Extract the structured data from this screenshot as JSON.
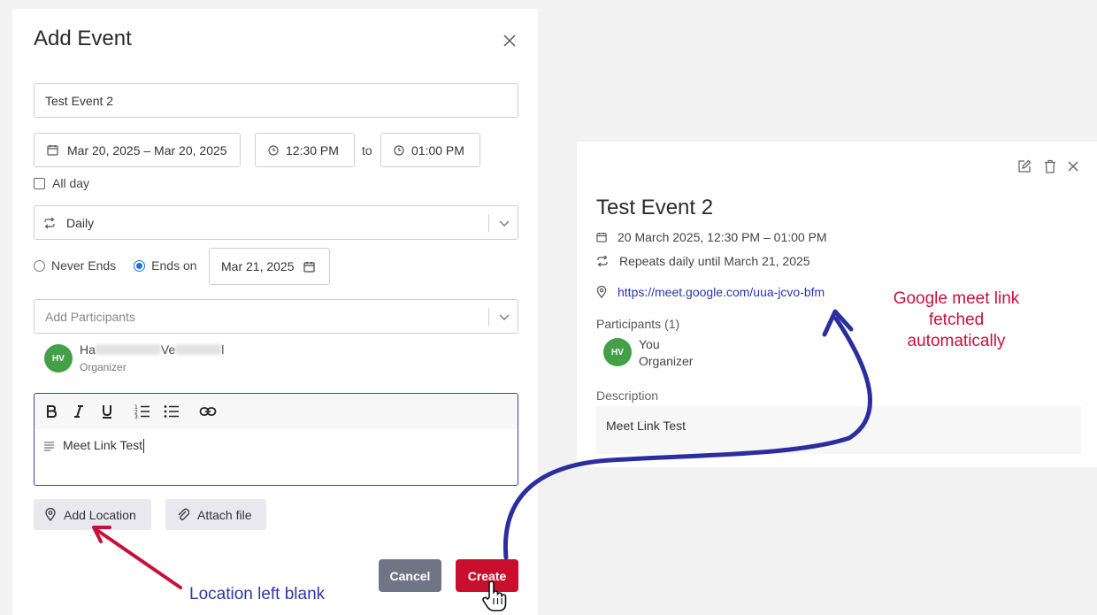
{
  "dialog": {
    "title": "Add Event",
    "event_title_value": "Test Event 2",
    "date_range": "Mar 20, 2025 – Mar 20, 2025",
    "start_time": "12:30 PM",
    "to_label": "to",
    "end_time": "01:00 PM",
    "all_day_label": "All day",
    "repeat_value": "Daily",
    "never_ends_label": "Never Ends",
    "ends_on_label": "Ends on",
    "ends_on_date": "Mar 21, 2025",
    "participants_placeholder": "Add Participants",
    "organizer": {
      "initials": "HV",
      "name_part1": "Ha",
      "name_part2": "Ve",
      "name_part3": "l",
      "role": "Organizer"
    },
    "description_text": "Meet Link Test",
    "add_location_label": "Add Location",
    "attach_file_label": "Attach file",
    "cancel_label": "Cancel",
    "create_label": "Create"
  },
  "details": {
    "title": "Test Event 2",
    "datetime": "20 March 2025, 12:30 PM – 01:00 PM",
    "repeat": "Repeats daily until March 21, 2025",
    "meet_link": "https://meet.google.com/uua-jcvo-bfm",
    "participants_label": "Participants (1)",
    "participant_initials": "HV",
    "participant_name": "You",
    "participant_role": "Organizer",
    "description_label": "Description",
    "description_value": "Meet Link Test"
  },
  "annotations": {
    "meet_note_line1": "Google meet link",
    "meet_note_line2": "fetched",
    "meet_note_line3": "automatically",
    "location_note": "Location left blank"
  },
  "colors": {
    "accent_blue": "#3236a8",
    "annotation_red": "#c8103c",
    "create_button": "#c8102e",
    "cancel_button": "#6f7587",
    "avatar_green": "#43a047"
  },
  "icons": [
    "close-icon",
    "calendar-icon",
    "clock-icon",
    "repeat-icon",
    "chevron-down-icon",
    "bold-icon",
    "italic-icon",
    "underline-icon",
    "ordered-list-icon",
    "bullet-list-icon",
    "link-icon",
    "paragraph-icon",
    "location-pin-icon",
    "paperclip-icon",
    "edit-icon",
    "trash-icon",
    "pointer-hand-icon"
  ]
}
